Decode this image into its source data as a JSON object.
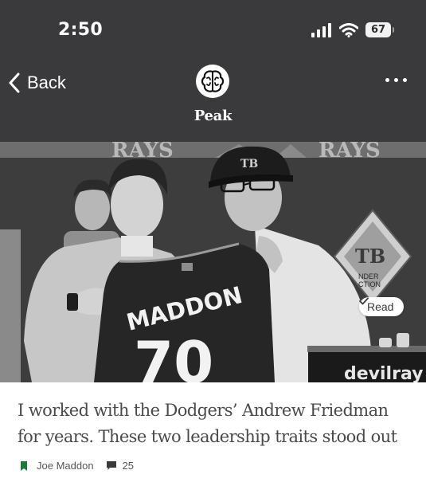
{
  "status_bar": {
    "time": "2:50",
    "battery_level": "67",
    "icons": [
      "signal-icon",
      "wifi-icon",
      "battery-icon"
    ]
  },
  "nav": {
    "back_label": "Back",
    "app_title": "Peak",
    "more_icon": "more-horizontal-icon",
    "logo_icon": "brain-icon"
  },
  "hero": {
    "read_label": "Read",
    "read_icon": "checkmark-icon",
    "jersey_name": "MADDON",
    "jersey_number": "70",
    "backdrop_logo": "RAYS",
    "cap_logo": "TB",
    "podium_text": "devilray",
    "sign_lines": [
      "NDER",
      "CTION"
    ]
  },
  "article": {
    "headline": "I worked with the Dodgers’ Andrew Friedman for years. These two leadership traits stood out",
    "author": "Joe Maddon",
    "comment_count": "25",
    "bookmark_icon": "bookmark-icon",
    "comment_icon": "comment-icon"
  },
  "colors": {
    "header_bg": "#3a3a3c",
    "bookmark_green": "#1f7a3a",
    "headline_text": "#4a4a4a",
    "meta_text": "#555555"
  }
}
